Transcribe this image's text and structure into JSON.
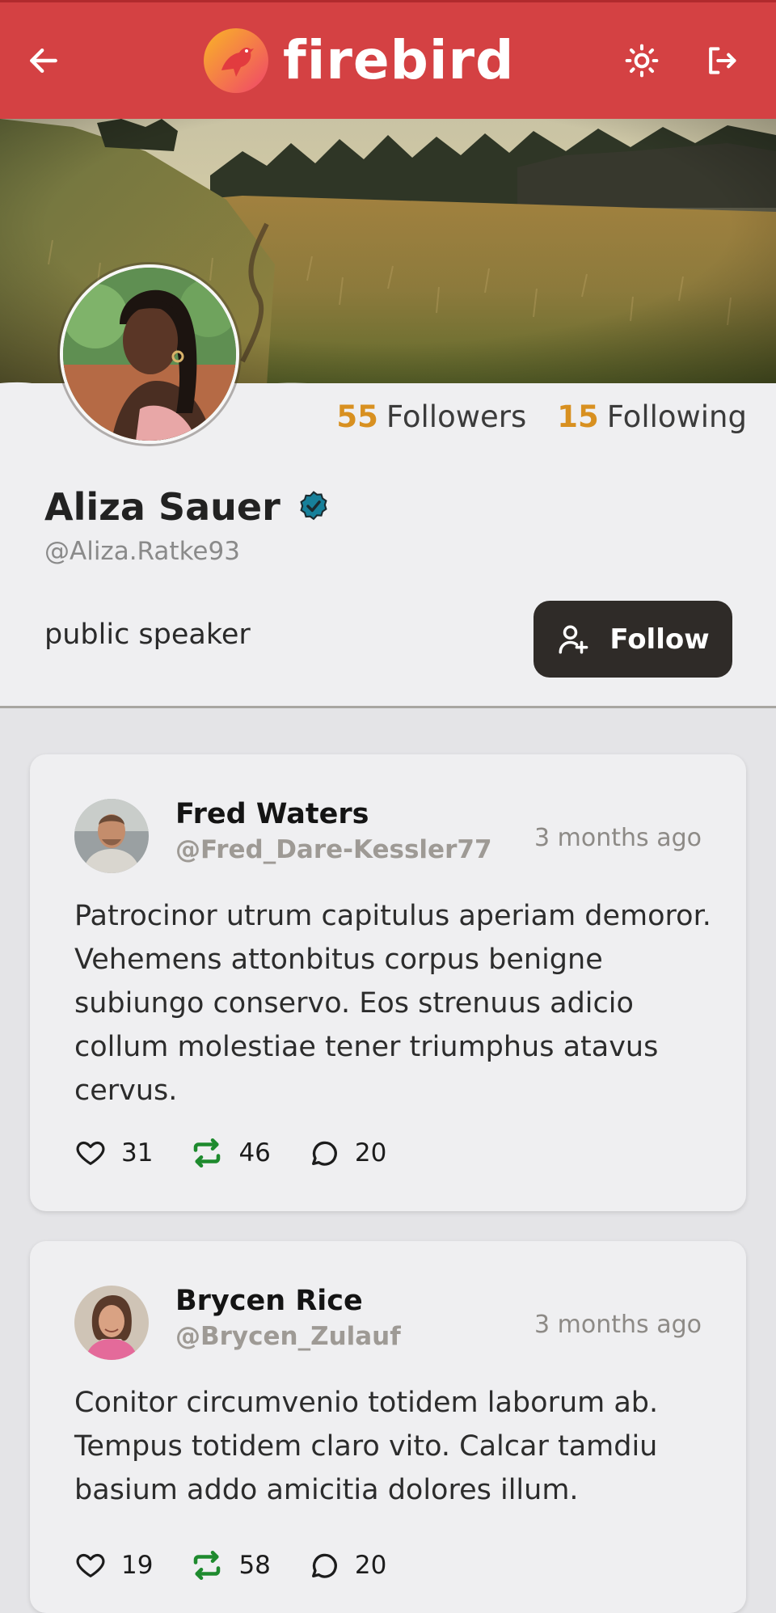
{
  "header": {
    "brand": "firebird",
    "back_icon": "arrow-left-icon",
    "theme_icon": "sun-icon",
    "logout_icon": "logout-icon",
    "colors": {
      "bar": "#d44143",
      "logo_start": "#f9a826",
      "logo_end": "#f0456a"
    }
  },
  "profile": {
    "name": "Aliza Sauer",
    "handle": "@Aliza.Ratke93",
    "bio": "public speaker",
    "verified": true,
    "followers_count": "55",
    "followers_label": "Followers",
    "following_count": "15",
    "following_label": "Following",
    "follow_label": "Follow",
    "colors": {
      "stat_number": "#d89020",
      "verified": "#17809a",
      "follow_button": "#2f2b28"
    }
  },
  "posts": [
    {
      "author": "Fred Waters",
      "handle": "@Fred_Dare-Kessler77",
      "time": "3 months ago",
      "body": "Patrocinor utrum capitulus aperiam demoror. Vehemens attonbitus corpus benigne subiungo conservo. Eos strenuus adicio collum molestiae tener triumphus atavus cervus.",
      "likes": "31",
      "reposts": "46",
      "comments": "20"
    },
    {
      "author": "Brycen Rice",
      "handle": "@Brycen_Zulauf",
      "time": "3 months ago",
      "body": "Conitor circumvenio totidem laborum ab. Tempus totidem claro vito. Calcar tamdiu basium addo amicitia dolores illum.",
      "likes": "19",
      "reposts": "58",
      "comments": "20"
    }
  ],
  "action_colors": {
    "repost": "#1e8a2e"
  }
}
